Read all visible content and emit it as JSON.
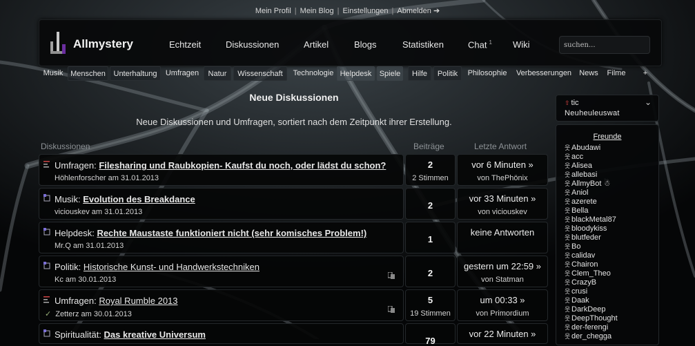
{
  "user_links": [
    "Mein Profil",
    "Mein Blog",
    "Einstellungen",
    "Abmelden ➔"
  ],
  "brand": "Allmystery",
  "main_nav": [
    {
      "label": "Echtzeit",
      "sup": ""
    },
    {
      "label": "Diskussionen",
      "sup": ""
    },
    {
      "label": "Artikel",
      "sup": ""
    },
    {
      "label": "Blogs",
      "sup": ""
    },
    {
      "label": "Statistiken",
      "sup": ""
    },
    {
      "label": "Chat",
      "sup": "1"
    },
    {
      "label": "Wiki",
      "sup": ""
    }
  ],
  "search": {
    "placeholder": "suchen..."
  },
  "categories": [
    {
      "label": "Musik",
      "style": ""
    },
    {
      "label": "Menschen",
      "style": "dim"
    },
    {
      "label": "Unterhaltung",
      "style": "dim"
    },
    {
      "label": "Umfragen",
      "style": ""
    },
    {
      "label": "Natur",
      "style": "dim"
    },
    {
      "label": "Wissenschaft",
      "style": "dim"
    },
    {
      "label": "Technologie",
      "style": ""
    },
    {
      "label": "Helpdesk",
      "style": "hl"
    },
    {
      "label": "Spiele",
      "style": "hl"
    },
    {
      "label": "Hilfe",
      "style": "dim"
    },
    {
      "label": "Politik",
      "style": "dim"
    },
    {
      "label": "Philosophie",
      "style": ""
    },
    {
      "label": "Verbesserungen",
      "style": ""
    },
    {
      "label": "News",
      "style": ""
    },
    {
      "label": "Filme",
      "style": ""
    },
    {
      "label": "+",
      "style": ""
    }
  ],
  "main": {
    "title": "Neue Diskussionen",
    "subtitle": "Neue Diskussionen und Umfragen, sortiert nach dem Zeitpunkt ihrer Erstellung.",
    "col_discussions": "Diskussionen",
    "col_posts": "Beiträge",
    "col_last": "Letzte Antwort"
  },
  "topics": [
    {
      "icon": "poll",
      "category": "Umfragen:",
      "title": "Filesharing und Raubkopien- Kaufst du noch, oder lädst du schon?",
      "bold": true,
      "author": "Höhlenforscher am 31.01.2013",
      "check": false,
      "comment_icon": false,
      "posts": "2",
      "votes": "2 Stimmen",
      "last_time": "vor 6 Minuten »",
      "last_user": "von ThePhönix"
    },
    {
      "icon": "topic",
      "category": "Musik:",
      "title": "Evolution des Breakdance ",
      "bold": true,
      "author": "viciouskev am 31.01.2013",
      "check": false,
      "comment_icon": false,
      "posts": "2",
      "votes": "",
      "last_time": "vor 33 Minuten »",
      "last_user": "von viciouskev"
    },
    {
      "icon": "topic",
      "category": "Helpdesk:",
      "title": "Rechte Maustaste funktioniert nicht (sehr komisches Problem!)",
      "bold": true,
      "author": "Mr.Q am 31.01.2013",
      "check": false,
      "comment_icon": false,
      "posts": "1",
      "votes": "",
      "last_time": "keine Antworten",
      "last_user": ""
    },
    {
      "icon": "topic",
      "category": "Politik:",
      "title": "Historische Kunst- und Handwerkstechniken",
      "bold": false,
      "author": "Kc am 30.01.2013",
      "check": false,
      "comment_icon": true,
      "posts": "2",
      "votes": "",
      "last_time": "gestern um 22:59 »",
      "last_user": "von Statman"
    },
    {
      "icon": "poll",
      "category": "Umfragen:",
      "title": "Royal Rumble 2013",
      "bold": false,
      "author": "Zetterz am 30.01.2013",
      "check": true,
      "comment_icon": true,
      "posts": "5",
      "votes": "19 Stimmen",
      "last_time": "um 00:33 »",
      "last_user": "von Primordium"
    },
    {
      "icon": "topic",
      "category": "Spiritualität:",
      "title": "Das kreative Universum",
      "bold": true,
      "author": "",
      "check": false,
      "comment_icon": false,
      "posts": "79",
      "votes": "",
      "last_time": "vor 22 Minuten »",
      "last_user": ""
    }
  ],
  "sidebar": {
    "top_line1": "tic",
    "top_line2": "Neuheuleuswat",
    "friends_heading": "Freunde",
    "friends": [
      "Abudawi",
      "acc",
      "Alisea",
      "allebasi",
      "AllmyBot ☃",
      "Aniol",
      "azerete",
      "Bella",
      "blackMetal87",
      "bloodykiss",
      "blutfeder",
      "Bo",
      "calidav",
      "Chairon",
      "Clem_Theo",
      "CrazyB",
      "crusi",
      "Daak",
      "DarkDeep",
      "DeepThought",
      "der-ferengi",
      "der_chegga"
    ]
  }
}
